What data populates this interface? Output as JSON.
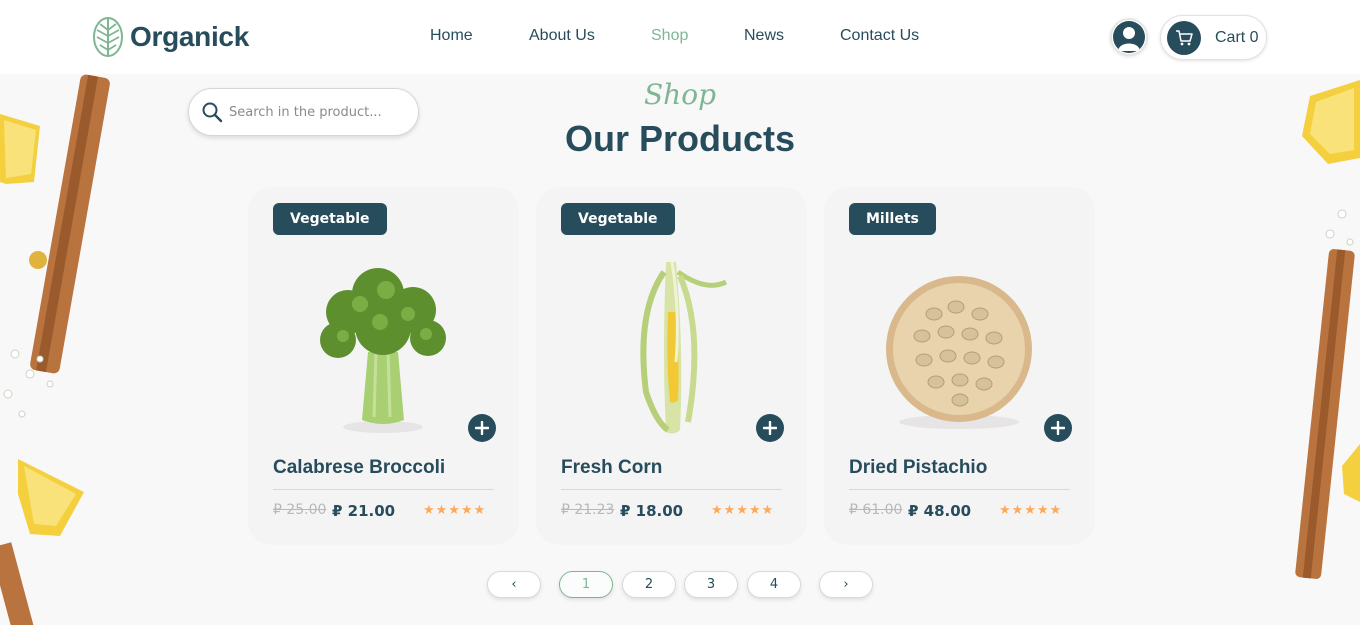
{
  "brand": {
    "name": "Organick",
    "logo_icon": "leaf-logo-icon"
  },
  "nav": {
    "items": [
      {
        "label": "Home",
        "active": false
      },
      {
        "label": "About Us",
        "active": false
      },
      {
        "label": "Shop",
        "active": true
      },
      {
        "label": "News",
        "active": false
      },
      {
        "label": "Contact Us",
        "active": false
      }
    ]
  },
  "header": {
    "user_icon": "user-icon",
    "cart_icon": "cart-icon",
    "cart_label": "Cart 0"
  },
  "search": {
    "placeholder": "Search in the product...",
    "value": "",
    "icon": "search-icon"
  },
  "section": {
    "subtitle": "Shop",
    "title": "Our Products"
  },
  "products": [
    {
      "category": "Vegetable",
      "name": "Calabrese Broccoli",
      "old_price": "₽ 25.00",
      "price": "₽ 21.00",
      "rating": 5,
      "image": "broccoli"
    },
    {
      "category": "Vegetable",
      "name": "Fresh Corn",
      "old_price": "₽ 21.23",
      "price": "₽ 18.00",
      "rating": 5,
      "image": "corn"
    },
    {
      "category": "Millets",
      "name": "Dried Pistachio",
      "old_price": "₽ 61.00",
      "price": "₽ 48.00",
      "rating": 5,
      "image": "pistachio"
    }
  ],
  "pagination": {
    "prev": "‹",
    "pages": [
      "1",
      "2",
      "3",
      "4"
    ],
    "current": "1",
    "next": "›"
  },
  "colors": {
    "primary": "#274c5b",
    "accent": "#7eb693",
    "star": "#ffa858",
    "card_bg": "#f5f4f4"
  }
}
